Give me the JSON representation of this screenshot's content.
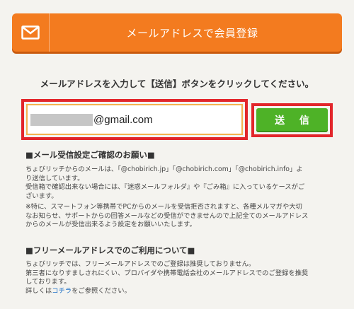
{
  "header": {
    "title": "メールアドレスで会員登録",
    "icon": "envelope-icon",
    "color": "#f37b1f"
  },
  "instruction": "メールアドレスを入力して【送信】ボタンをクリックしてください。",
  "email": {
    "domain_text": "@gmail.com"
  },
  "submit_label": "送 信",
  "notice": {
    "title": "■メール受信設定ご確認のお願い■",
    "lines_1": [
      "ちょびリッチからのメールは、「@chobirich.jp」「@chobirich.com」「@chobirich.info」よ",
      "り送信しています。",
      "受信箱で確認出来ない場合には、『迷惑メールフォルダ』や『ごみ箱』に入っているケースがご",
      "ざいます。"
    ],
    "lines_2": [
      "※特に、スマートフォン等携帯でPCからのメールを受信拒否されますと、各種メルマガや大切",
      "なお知らせ、サポートからの回答メールなどの受信ができませんので上記全てのメールアドレス",
      "からのメールが受信出来るよう設定をお願いいたします。"
    ]
  },
  "free_mail": {
    "title": "■フリーメールアドレスでのご利用について■",
    "lines": [
      "ちょびリッチでは、フリーメールアドレスでのご登録は推奨しておりません。",
      "第三者になりすましされにくい、プロバイダや携帯電話会社のメールアドレスでのご登録を推奨",
      "しております。"
    ],
    "details_prefix": "詳しくは",
    "details_link": "コチラ",
    "details_suffix": "をご参照ください。"
  }
}
